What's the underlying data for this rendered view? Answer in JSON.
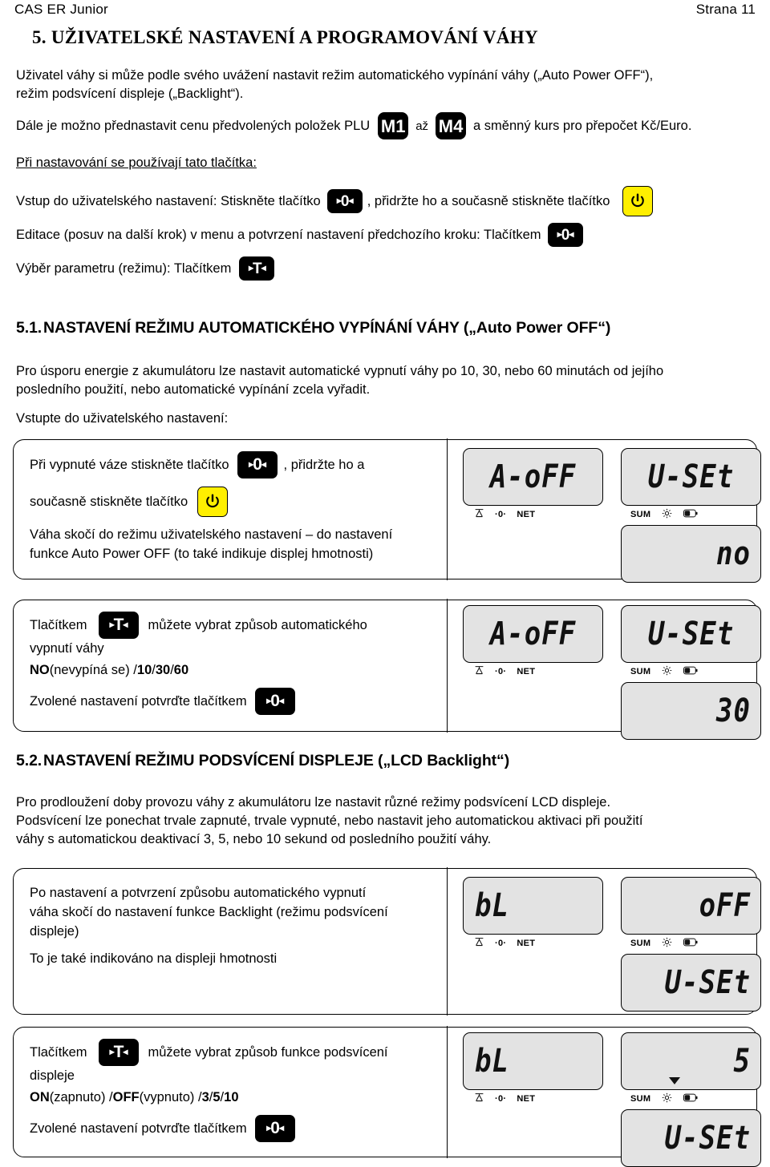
{
  "header": {
    "left": "CAS ER Junior",
    "right": "Strana 11"
  },
  "title": "5. UŽIVATELSKÉ NASTAVENÍ A PROGRAMOVÁNÍ VÁHY",
  "intro": {
    "line1": "Uživatel váhy si může podle svého uvážení nastavit režim automatického vypínání váhy („Auto Power OFF“),",
    "line2": "režim podsvícení displeje („Backlight“).",
    "plu_before": "Dále je možno přednastavit cenu předvolených položek PLU",
    "plu_m1": "M1",
    "plu_az": "až",
    "plu_m4": "M4",
    "plu_after": "a směnný kurs pro přepočet Kč/Euro."
  },
  "keys_section": {
    "heading": "Při nastavování se používají tato tlačítka:",
    "row1_before": "Vstup do uživatelského nastavení:  Stiskněte tlačítko",
    "row1_middle": ", přidržte ho a současně stiskněte tlačítko",
    "row2_before": "Editace (posuv na další krok) v menu a potvrzení nastavení předchozího kroku:  Tlačítkem",
    "row3_before": "Výběr parametru (režimu):  Tlačítkem"
  },
  "section51": {
    "number": "5.1.",
    "title": "NASTAVENÍ REŽIMU AUTOMATICKÉHO VYPÍNÁNÍ VÁHY („Auto Power OFF“)",
    "para_line1": "Pro úsporu energie z akumulátoru lze nastavit automatické vypnutí váhy po 10, 30, nebo 60 minutách od jejího",
    "para_line2": "posledního použití, nebo automatické vypínání zcela vyřadit.",
    "enter": "Vstupte do uživatelského nastavení:"
  },
  "panel1": {
    "l1_before": "Při vypnuté váze stiskněte tlačítko",
    "l1_after": ", přidržte ho a",
    "l2_before": "současně stiskněte tlačítko",
    "l3": "Váha skočí do režimu uživatelského nastavení – do nastavení",
    "l4": "funkce Auto Power OFF (to také indikuje displej hmotnosti)",
    "lcd": {
      "main_left": "A-oFF",
      "main_right": "U-SEt",
      "sub_right": "no",
      "ind_left": [
        "scale-icon",
        "-0-",
        "NET"
      ],
      "ind_right": [
        "SUM",
        "sun-icon",
        "battery-icon"
      ]
    }
  },
  "panel2": {
    "l1_before": "Tlačítkem",
    "l1_after": "můžete vybrat způsob automatického",
    "l2": "vypnutí váhy",
    "l3_bold1": "NO",
    "l3_rest1": " (nevypíná se) / ",
    "l3_bold2": "10",
    "l3_sep1": " / ",
    "l3_bold3": "30",
    "l3_sep2": " / ",
    "l3_bold4": "60",
    "l4": "Zvolené nastavení potvrďte tlačítkem",
    "lcd": {
      "main_left": "A-oFF",
      "main_right": "U-SEt",
      "sub_right": "30",
      "ind_left": [
        "scale-icon",
        "-0-",
        "NET"
      ],
      "ind_right": [
        "SUM",
        "sun-icon",
        "battery-icon"
      ]
    }
  },
  "section52": {
    "number": "5.2.",
    "title": "NASTAVENÍ REŽIMU PODSVÍCENÍ DISPLEJE („LCD Backlight“)",
    "para_line1": "Pro prodloužení doby provozu váhy z akumulátoru lze nastavit různé režimy podsvícení LCD displeje.",
    "para_line2": "Podsvícení lze ponechat trvale zapnuté, trvale vypnuté, nebo nastavit jeho automatickou aktivaci při použití",
    "para_line3": "váhy s automatickou deaktivací 3, 5, nebo 10 sekund od posledního použití váhy."
  },
  "panel3": {
    "l1": "Po nastavení a potvrzení způsobu automatického vypnutí",
    "l2": "váha skočí do nastavení funkce Backlight (režimu podsvícení",
    "l3": "displeje)",
    "l4": "To je také indikováno na displeji hmotnosti",
    "lcd": {
      "main_left": "bL",
      "main_right": "oFF",
      "sub_right": "U-SEt",
      "ind_left": [
        "scale-icon",
        "-0-",
        "NET"
      ],
      "ind_right": [
        "SUM",
        "sun-icon",
        "battery-icon"
      ]
    }
  },
  "panel4": {
    "l1_before": "Tlačítkem",
    "l1_after": "můžete vybrat způsob funkce podsvícení",
    "l2": "displeje",
    "l3_bold1": "ON",
    "l3_rest1": " (zapnuto) / ",
    "l3_bold2": "OFF",
    "l3_rest2": " (vypnuto) / ",
    "l3_bold3": "3",
    "l3_sep1": " / ",
    "l3_bold4": "5",
    "l3_sep2": " / ",
    "l3_bold5": "10",
    "l4": "Zvolené nastavení potvrďte tlačítkem",
    "lcd": {
      "main_left": "bL",
      "main_right": "5",
      "sub_right": "U-SEt",
      "ind_left": [
        "scale-icon",
        "-0-",
        "NET"
      ],
      "ind_right": [
        "SUM",
        "sun-icon",
        "battery-icon"
      ]
    }
  },
  "keys": {
    "zero_label": "0",
    "tare_label": "T",
    "arrow_left": "▸",
    "arrow_right": "◂",
    "power_name": "power-icon"
  },
  "colors": {
    "power_key_bg": "#ffef00",
    "key_bg": "#000000",
    "lcd_bg": "#e3e3e3",
    "page_bg": "#ffffff"
  }
}
